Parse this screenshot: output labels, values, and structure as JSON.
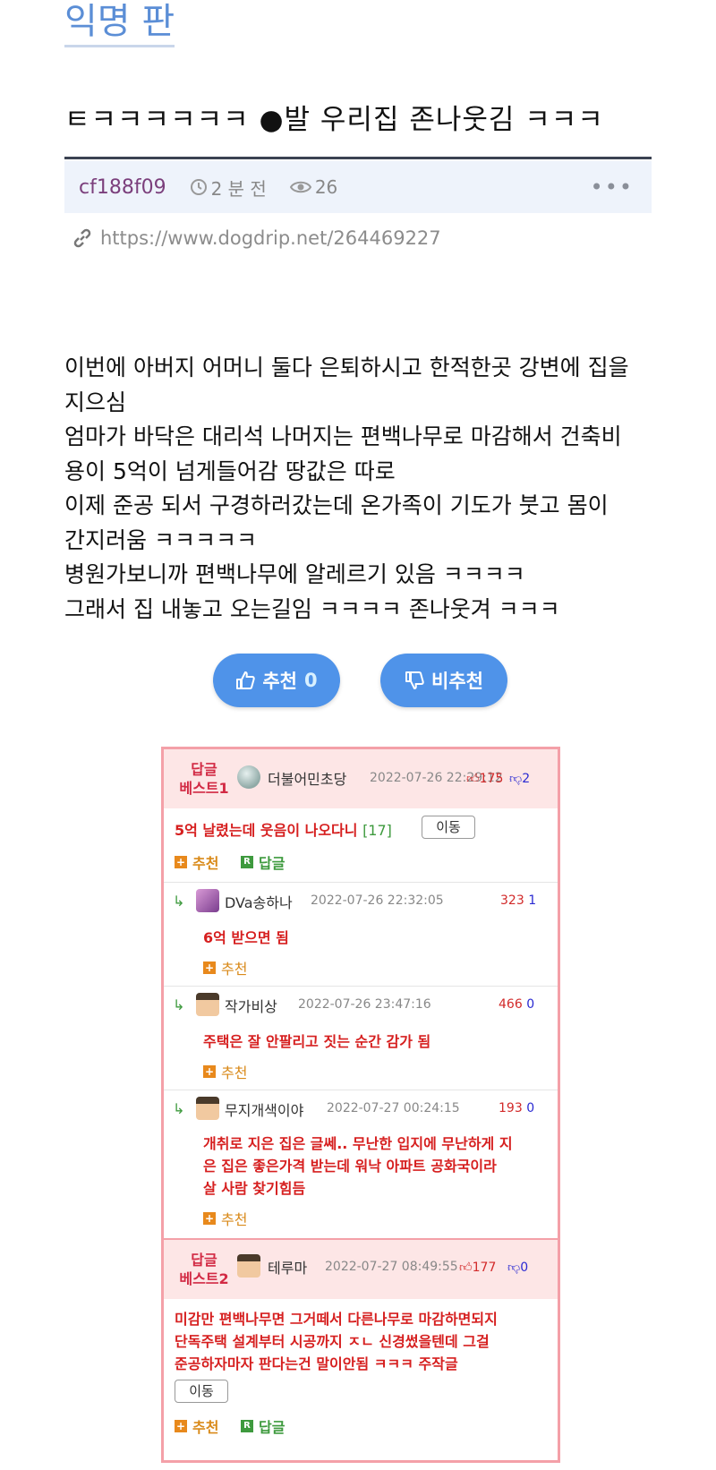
{
  "board_title": "익명 판",
  "post": {
    "title": "ㅌㅋㅋㅋㅋㅋㅋ ●발 우리집 존나웃김 ㅋㅋㅋ",
    "author": "cf188f09",
    "time": "2 분 전",
    "views": "26",
    "link": "https://www.dogdrip.net/264469227",
    "body_lines": [
      "이번에 아버지 어머니 둘다 은퇴하시고 한적한곳 강변에 집을",
      "지으심",
      "엄마가 바닥은 대리석 나머지는 편백나무로 마감해서 건축비",
      "용이 5억이 넘게들어감 땅값은 따로",
      "이제 준공 되서 구경하러갔는데 온가족이 기도가 붓고 몸이",
      "간지러움 ㅋㅋㅋㅋㅋ",
      "병원가보니까 편백나무에 알레르기 있음 ㅋㅋㅋㅋ",
      "그래서 집 내놓고 오는길임 ㅋㅋㅋㅋ 존나웃겨 ㅋㅋㅋ"
    ],
    "upvote_label": "추천",
    "upvote_count": "0",
    "downvote_label": "비추천"
  },
  "comments": {
    "best1": {
      "label_line1": "답글",
      "label_line2": "베스트1",
      "nick": "더불어민초당",
      "date": "2022-07-26 22:29:12",
      "up": "175",
      "down": "2",
      "text": "5억 날렸는데 웃음이 나오다니",
      "reply_count": "[17]",
      "move_label": "이동",
      "recommend_label": "추천",
      "reply_label": "답글"
    },
    "replies": [
      {
        "nick": "DVa송하나",
        "date": "2022-07-26 22:32:05",
        "up": "323",
        "down": "1",
        "text": "6억 받으면 됨",
        "recommend_label": "추천"
      },
      {
        "nick": "작가비상",
        "date": "2022-07-26 23:47:16",
        "up": "466",
        "down": "0",
        "text": "주택은 잘 안팔리고 짓는 순간 감가 됨",
        "recommend_label": "추천"
      },
      {
        "nick": "무지개색이야",
        "date": "2022-07-27 00:24:15",
        "up": "193",
        "down": "0",
        "text_lines": [
          "개취로 지은 집은 글쎄.. 무난한 입지에 무난하게 지",
          "은 집은 좋은가격 받는데 워낙 아파트 공화국이라",
          "살 사람 찾기힘듬"
        ],
        "recommend_label": "추천"
      }
    ],
    "best2": {
      "label_line1": "답글",
      "label_line2": "베스트2",
      "nick": "테루마",
      "date": "2022-07-27 08:49:55",
      "up": "177",
      "down": "0",
      "text_lines": [
        "미감만 편백나무면 그거떼서 다른나무로 마감하면되지",
        "단독주택 설계부터 시공까지 ㅈㄴ 신경썼을텐데 그걸",
        "준공하자마자 판다는건 말이안됨 ㅋㅋㅋ 주작글"
      ],
      "move_label": "이동",
      "recommend_label": "추천",
      "reply_label": "답글"
    }
  },
  "colors": {
    "accent_blue": "#4f93e9",
    "best_pink": "#fde6e6",
    "comment_red": "#d61f1f"
  }
}
